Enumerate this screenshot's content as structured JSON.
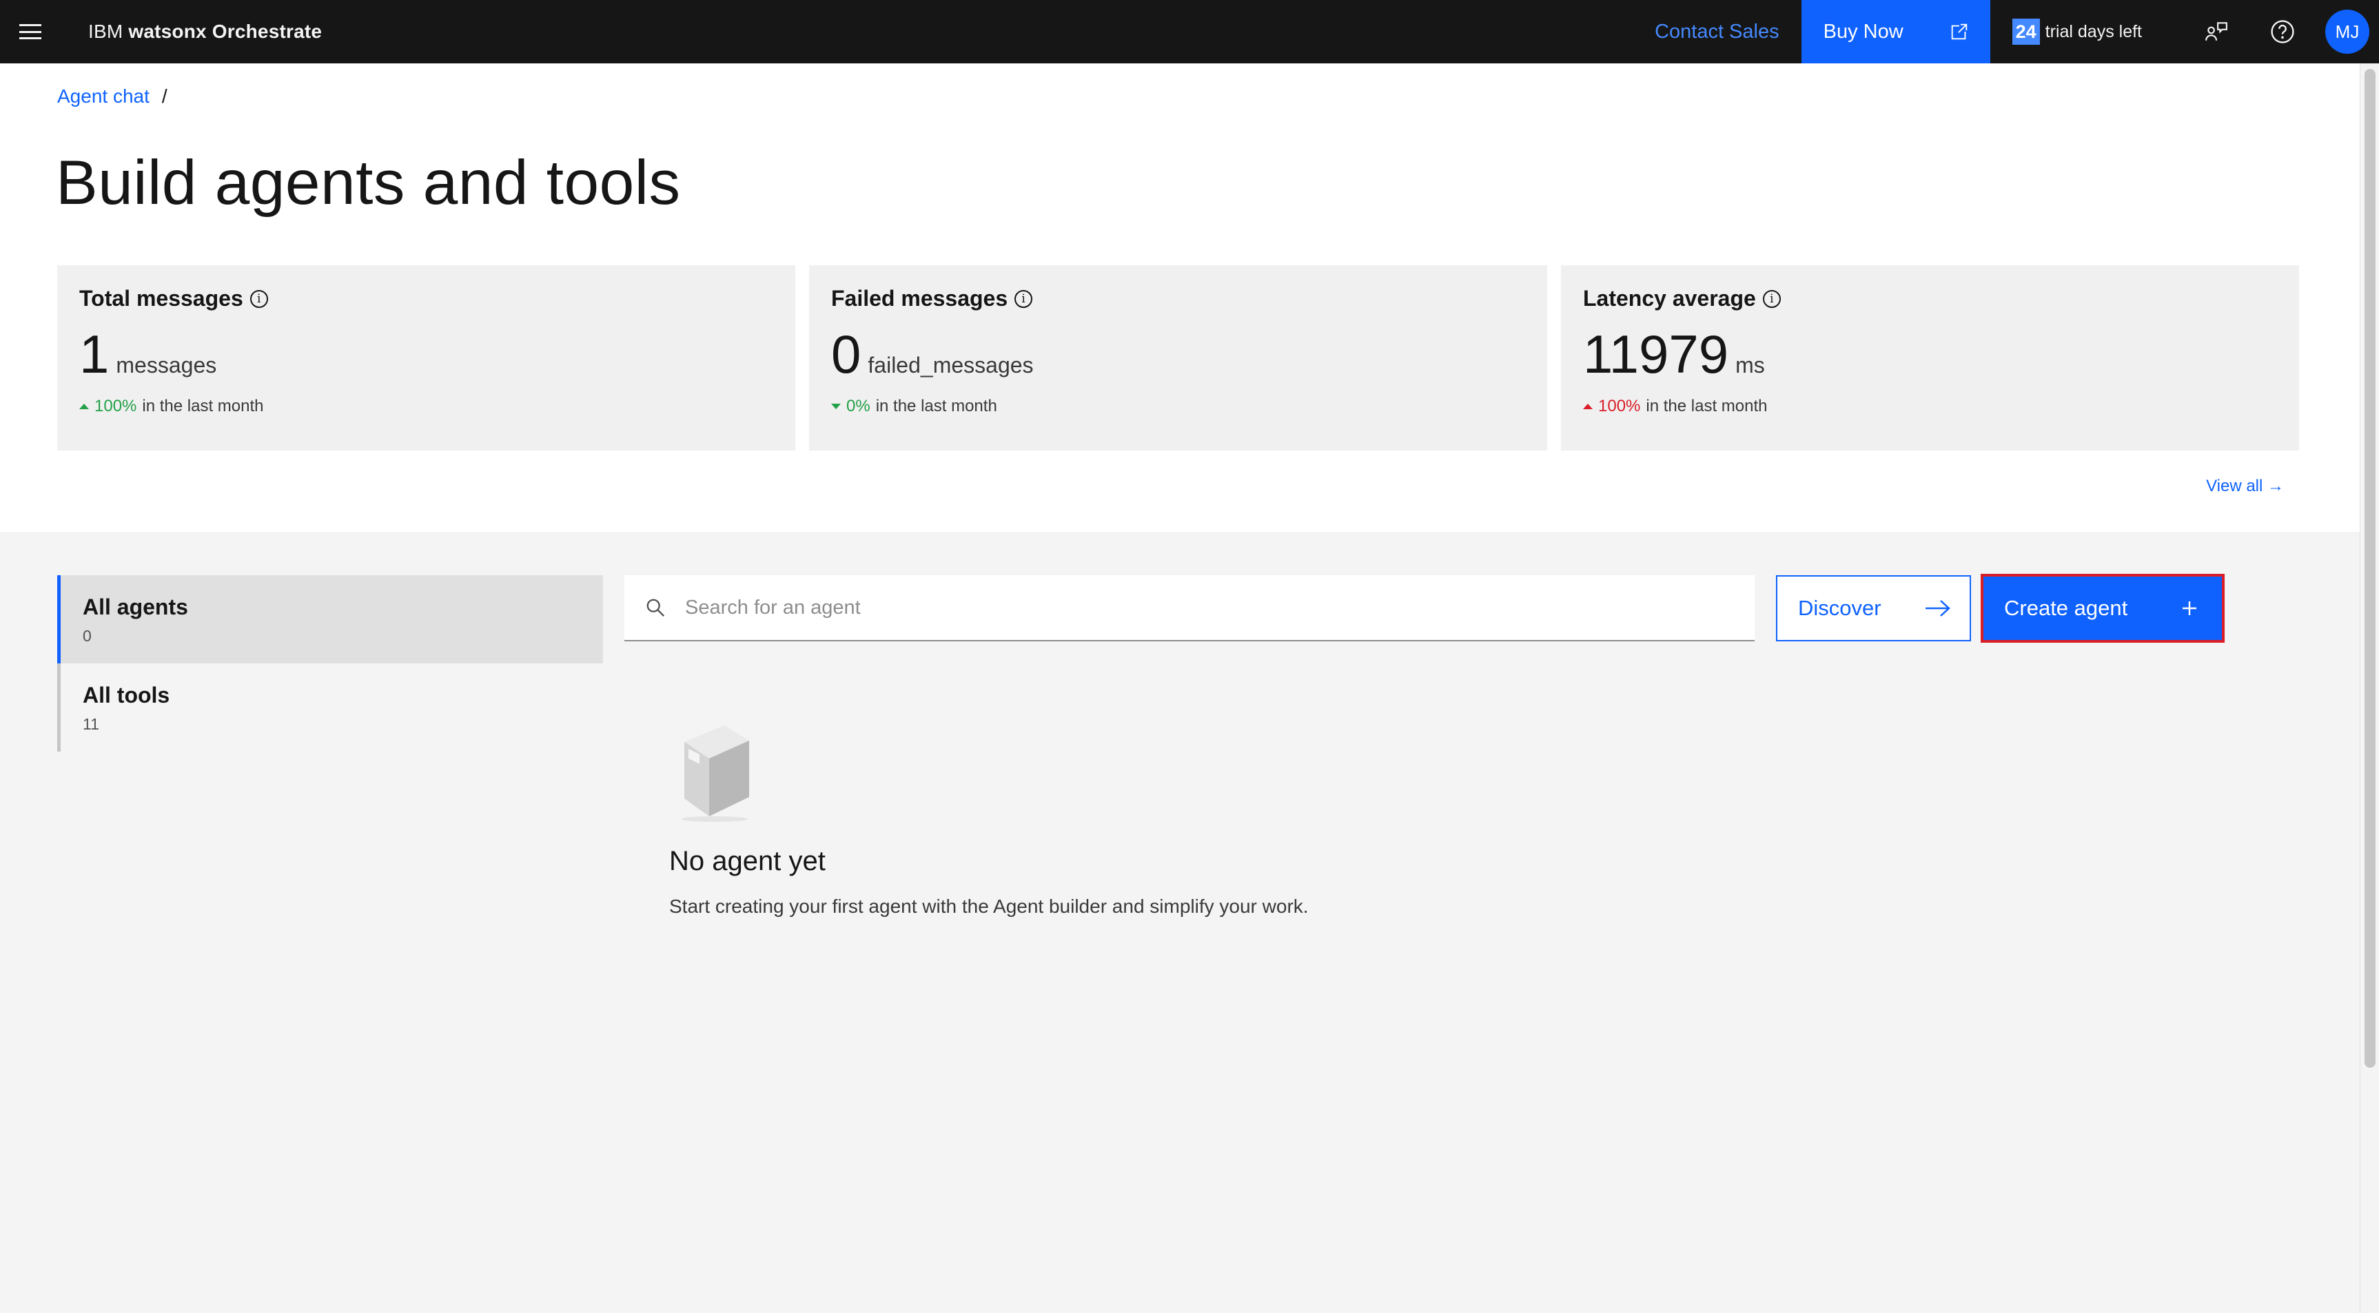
{
  "header": {
    "brand_prefix": "IBM",
    "brand_name": "watsonx Orchestrate",
    "contact_sales": "Contact Sales",
    "buy_now": "Buy Now",
    "trial_days": "24",
    "trial_text": "trial days left",
    "avatar_initials": "MJ"
  },
  "breadcrumb": {
    "items": [
      "Agent chat"
    ],
    "separator": "/"
  },
  "page": {
    "title": "Build agents and tools"
  },
  "stats": [
    {
      "label": "Total messages",
      "value": "1",
      "unit": "messages",
      "trend_pct": "100%",
      "trend_text": "in the last month",
      "trend_dir": "up",
      "trend_color": "#24a148"
    },
    {
      "label": "Failed messages",
      "value": "0",
      "unit": "failed_messages",
      "trend_pct": "0%",
      "trend_text": "in the last month",
      "trend_dir": "down",
      "trend_color": "#24a148"
    },
    {
      "label": "Latency average",
      "value": "11979",
      "unit": "ms",
      "trend_pct": "100%",
      "trend_text": "in the last month",
      "trend_dir": "up",
      "trend_color": "#da1e28"
    }
  ],
  "view_all": "View all →",
  "nav": {
    "items": [
      {
        "label": "All agents",
        "count": "0"
      },
      {
        "label": "All tools",
        "count": "11"
      }
    ]
  },
  "search": {
    "placeholder": "Search for an agent",
    "value": ""
  },
  "actions": {
    "discover": "Discover",
    "create": "Create agent"
  },
  "empty": {
    "title": "No agent yet",
    "description": "Start creating your first agent with the Agent builder and simplify your work."
  },
  "colors": {
    "primary": "#0f62fe",
    "header_bg": "#161616",
    "success": "#24a148",
    "danger": "#da1e28",
    "highlight_outline": "#da1e28"
  },
  "icons": [
    "menu-icon",
    "launch-icon",
    "user-feedback-icon",
    "help-icon",
    "info-icon",
    "search-icon",
    "arrow-right-icon",
    "add-icon",
    "box-icon",
    "caret-up-icon",
    "caret-down-icon"
  ]
}
